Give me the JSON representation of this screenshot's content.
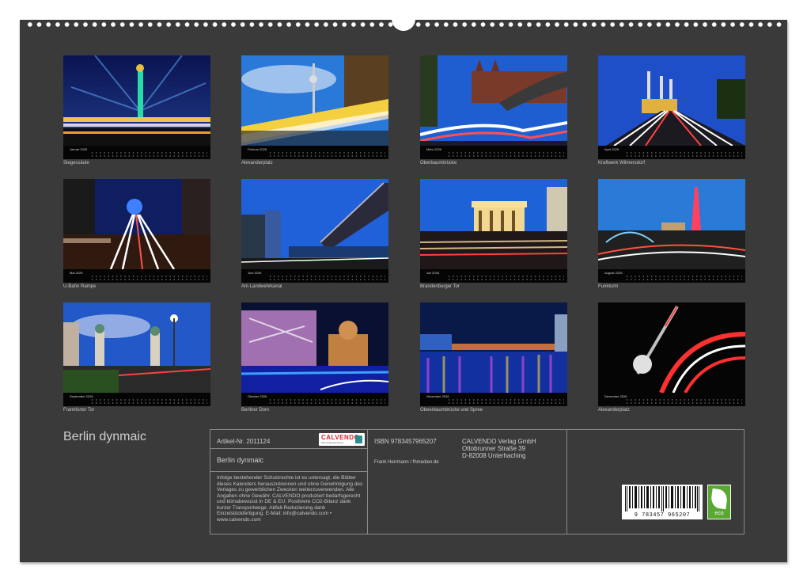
{
  "calendar_title": "Berlin dynmaic",
  "months": [
    {
      "name": "Januar 2026",
      "caption": "Siegessäule"
    },
    {
      "name": "Februar 2026",
      "caption": "Alexanderplatz"
    },
    {
      "name": "März 2026",
      "caption": "Oberbaumbrücke"
    },
    {
      "name": "April 2026",
      "caption": "Kraftwerk Wilmersdorf"
    },
    {
      "name": "Mai 2026",
      "caption": "U-Bahn Rampe"
    },
    {
      "name": "Juni 2026",
      "caption": "Am Landwehrkanal"
    },
    {
      "name": "Juli 2026",
      "caption": "Brandenburger Tor"
    },
    {
      "name": "August 2026",
      "caption": "Funkturm"
    },
    {
      "name": "September 2026",
      "caption": "Frankfurter Tor"
    },
    {
      "name": "Oktober 2026",
      "caption": "Berliner Dom"
    },
    {
      "name": "November 2026",
      "caption": "Obeerbaumbrücke und Spree"
    },
    {
      "name": "Dezember 2026",
      "caption": "Alexanderplatz"
    }
  ],
  "info": {
    "article": "Artikel-Nr. 2011124",
    "logo_name": "CALVENDO",
    "logo_tagline": "Mein Kalenderverlag",
    "product_title": "Berlin dynmaic",
    "legal_text": "Infolge bestehender Schutzrechte ist es untersagt, die Blätter dieses Kalenders herauszutrennen und ohne Genehmigung des Verlages zu gewerblichen Zwecken weiterzuverwenden. Alle Angaben ohne Gewähr. CALVENDO produziert bedarfsgerecht und klimabewusst in DE & EU. Positivere CO2-Bilanz dank kurzer Transportwege. Abfall-Reduzierung dank Einzelstückfertigung. E-Mail: info@calvendo.com • www.calvendo.com",
    "isbn": "ISBN 9783457965207",
    "author": "Frank Herrmann / fhmedien.de",
    "publisher_name": "CALVENDO Verlag GmbH",
    "publisher_street": "Ottobrunner Straße 39",
    "publisher_city": "D-82008 Unterhaching",
    "barcode_number": "9 783457 965207",
    "eco_label": "eco"
  }
}
